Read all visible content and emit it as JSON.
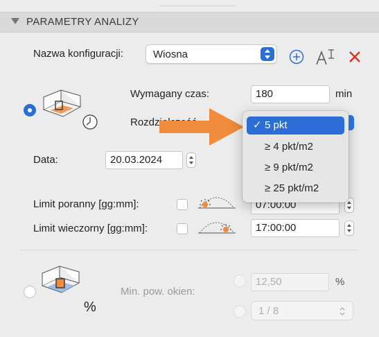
{
  "section": {
    "title": "PARAMETRY ANALIZY"
  },
  "config": {
    "label": "Nazwa konfiguracji:",
    "value": "Wiosna",
    "add_icon": "plus-circle-icon",
    "rename_icon": "rename-text-icon",
    "delete_icon": "close-x-icon"
  },
  "time_required": {
    "label": "Wymagany czas:",
    "value": "180",
    "unit": "min"
  },
  "resolution": {
    "label": "Rozdzielczość",
    "options": [
      {
        "label": "5 pkt",
        "selected": true
      },
      {
        "label": "≥ 4 pkt/m2",
        "selected": false
      },
      {
        "label": "≥ 9 pkt/m2",
        "selected": false
      },
      {
        "label": "≥ 25 pkt/m2",
        "selected": false
      }
    ],
    "check_mark": "✓"
  },
  "date": {
    "label": "Data:",
    "value": "20.03.2024"
  },
  "morning_limit": {
    "label": "Limit poranny [gg:mm]:",
    "value": "07:00:00"
  },
  "evening_limit": {
    "label": "Limit wieczorny [gg:mm]:",
    "value": "17:00:00"
  },
  "window_area": {
    "label": "Min. pow. okien:",
    "percent_value": "12,50",
    "percent_unit": "%",
    "ratio_value": "1 / 8",
    "icon_unit": "%"
  },
  "colors": {
    "accent": "#2b6fd6",
    "delete": "#e0301e",
    "arrow": "#f08a3c",
    "floor": "#f08a3c"
  }
}
